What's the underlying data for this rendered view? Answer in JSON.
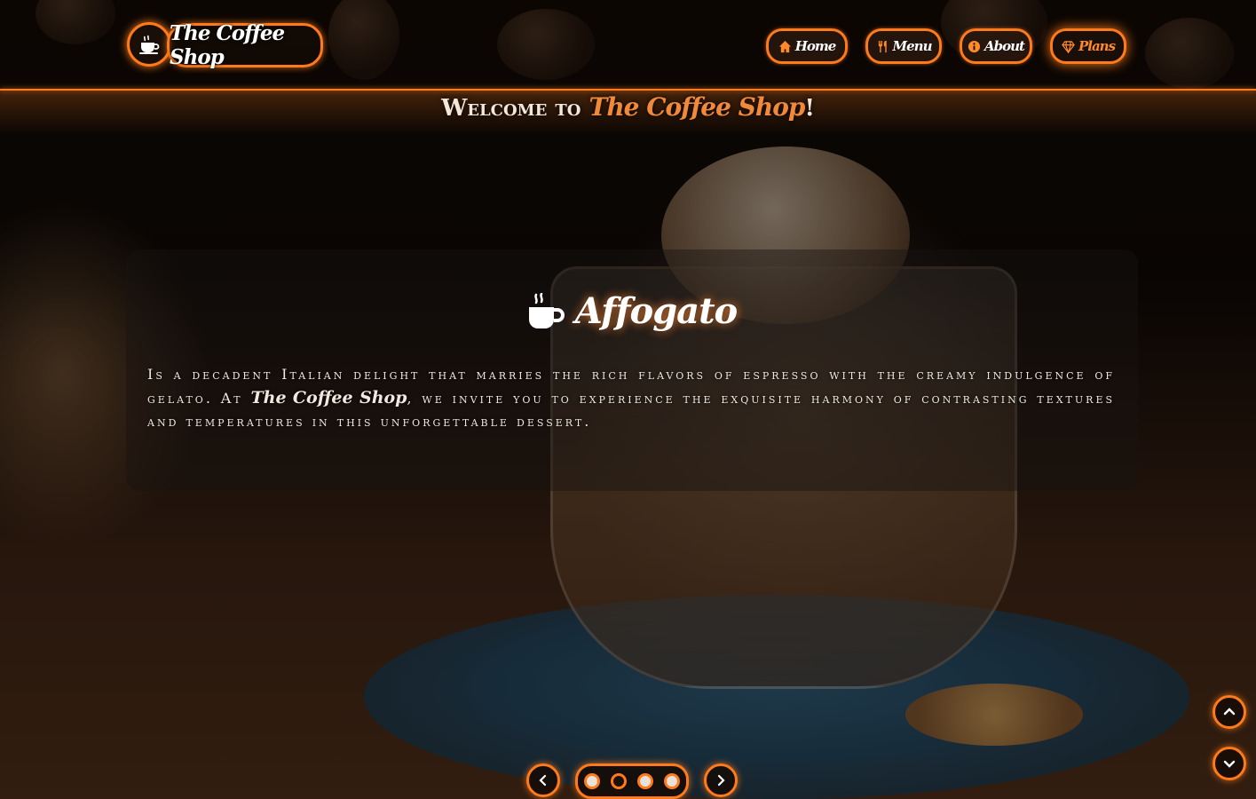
{
  "header": {
    "logo_text": "The Coffee Shop",
    "nav": [
      {
        "label": "Home",
        "icon": "home-icon"
      },
      {
        "label": "Menu",
        "icon": "utensils-icon"
      },
      {
        "label": "About",
        "icon": "info-icon"
      },
      {
        "label": "Plans",
        "icon": "gem-icon",
        "active": true
      }
    ]
  },
  "welcome": {
    "prefix": "Welcome to ",
    "brand": "The Coffee Shop",
    "suffix": "!"
  },
  "slide": {
    "icon": "mug-hot-icon",
    "title": "Affogato",
    "text_before": "Is a decadent Italian delight that marries the rich flavors of espresso with the creamy indulgence of gelato. At ",
    "brand": "The Coffee Shop",
    "text_after": ", we invite you to experience the exquisite harmony of contrasting textures and temperatures in this unforgettable dessert."
  },
  "carousel": {
    "slide_count": 4,
    "active_index": 1
  },
  "colors": {
    "accent": "#ff7a1a",
    "brand_text": "#f08a3a"
  }
}
